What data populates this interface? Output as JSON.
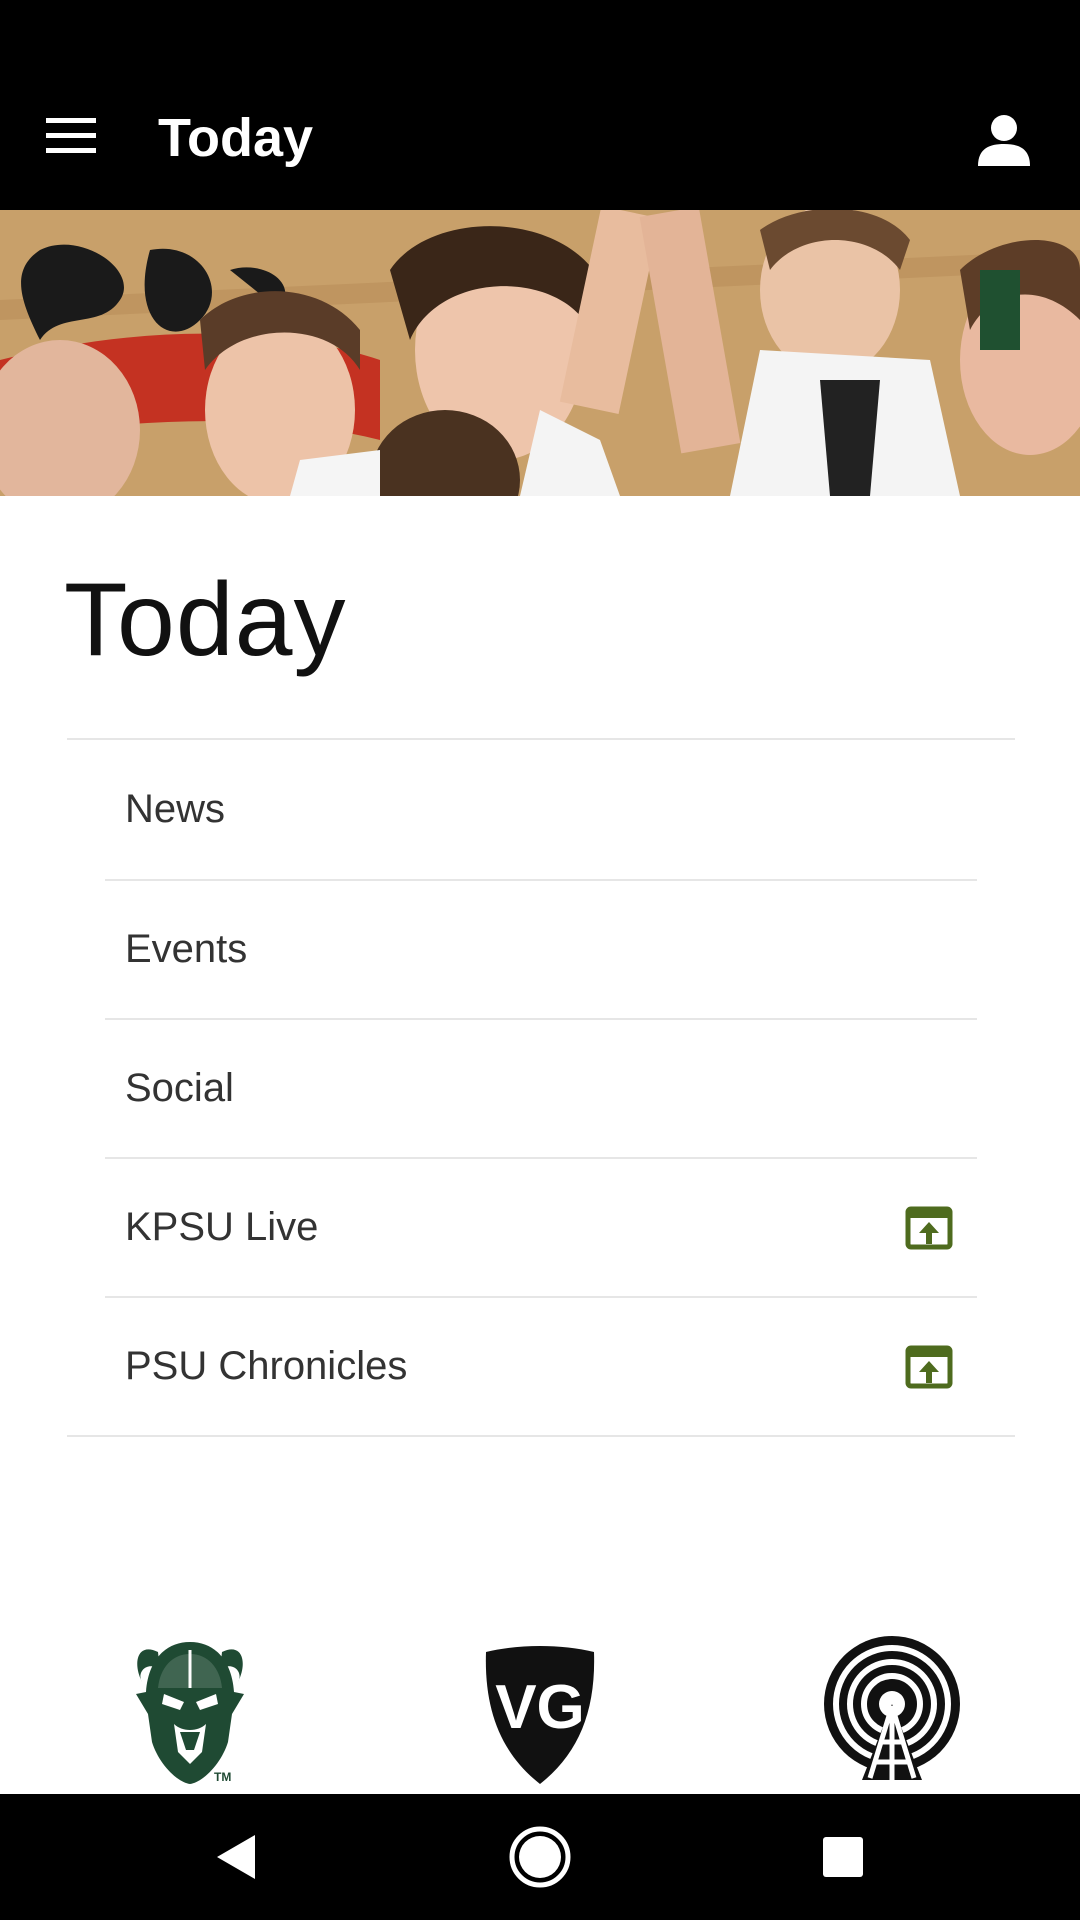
{
  "app_bar": {
    "title": "Today",
    "menu_icon": "hamburger-menu-icon",
    "account_icon": "person-icon"
  },
  "hero": {
    "description": ""
  },
  "page": {
    "title": "Today"
  },
  "nav_items": [
    {
      "label": "News",
      "external": false
    },
    {
      "label": "Events",
      "external": false
    },
    {
      "label": "Social",
      "external": false
    },
    {
      "label": "KPSU Live",
      "external": true
    },
    {
      "label": "PSU Chronicles",
      "external": true
    }
  ],
  "logos": {
    "left": {
      "icon": "viking-mascot-logo",
      "mark": "TM"
    },
    "center": {
      "icon": "vg-shield-logo",
      "text": "VG"
    },
    "right": {
      "icon": "radio-broadcast-logo"
    }
  },
  "colors": {
    "app_bar": "#000000",
    "accent_green": "#4e6b1e",
    "psu_green": "#1f4a33",
    "divider": "#e6e6e6",
    "text": "#333333"
  },
  "system_nav": {
    "icons": [
      "back-icon",
      "home-icon",
      "recents-icon"
    ]
  }
}
